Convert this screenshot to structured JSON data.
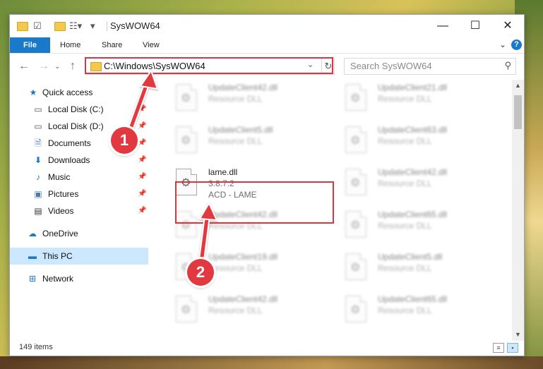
{
  "window": {
    "title": "SysWOW64"
  },
  "ribbon": {
    "file": "File",
    "tabs": [
      "Home",
      "Share",
      "View"
    ],
    "help": "?"
  },
  "navigation": {
    "address_path": "C:\\Windows\\SysWOW64",
    "search_placeholder": "Search SysWOW64"
  },
  "sidebar": {
    "items": [
      {
        "label": "Quick access",
        "icon": "star-icon",
        "pinned": false
      },
      {
        "label": "Local Disk (C:)",
        "icon": "drive-icon",
        "pinned": true
      },
      {
        "label": "Local Disk (D:)",
        "icon": "drive-icon",
        "pinned": true
      },
      {
        "label": "Documents",
        "icon": "documents-icon",
        "pinned": true
      },
      {
        "label": "Downloads",
        "icon": "download-icon",
        "pinned": true
      },
      {
        "label": "Music",
        "icon": "music-icon",
        "pinned": true
      },
      {
        "label": "Pictures",
        "icon": "pictures-icon",
        "pinned": true
      },
      {
        "label": "Videos",
        "icon": "videos-icon",
        "pinned": true
      },
      {
        "label": "OneDrive",
        "icon": "cloud-icon",
        "pinned": false
      },
      {
        "label": "This PC",
        "icon": "computer-icon",
        "pinned": false
      },
      {
        "label": "Network",
        "icon": "network-icon",
        "pinned": false
      }
    ]
  },
  "files": [
    {
      "name": "UpdateClient42.dll",
      "line1": "Resource DLL",
      "line2": ""
    },
    {
      "name": "UpdateClient21.dll",
      "line1": "Resource DLL",
      "line2": ""
    },
    {
      "name": "UpdateClient5.dll",
      "line1": "Resource DLL",
      "line2": ""
    },
    {
      "name": "UpdateClient63.dll",
      "line1": "Resource DLL",
      "line2": ""
    },
    {
      "name": "lame.dll",
      "line1": "3.8.7.2",
      "line2": "ACD - LAME"
    },
    {
      "name": "UpdateClient42.dll",
      "line1": "Resource DLL",
      "line2": ""
    },
    {
      "name": "UpdateClient42.dll",
      "line1": "Resource DLL",
      "line2": ""
    },
    {
      "name": "UpdateClient65.dll",
      "line1": "Resource DLL",
      "line2": ""
    },
    {
      "name": "UpdateClient19.dll",
      "line1": "Resource DLL",
      "line2": ""
    },
    {
      "name": "UpdateClient5.dll",
      "line1": "Resource DLL",
      "line2": ""
    },
    {
      "name": "UpdateClient42.dll",
      "line1": "Resource DLL",
      "line2": ""
    },
    {
      "name": "UpdateClient65.dll",
      "line1": "Resource DLL",
      "line2": ""
    }
  ],
  "status": {
    "item_count": "149 items"
  },
  "annotations": {
    "step1": "1",
    "step2": "2",
    "color": "#e2383f"
  }
}
